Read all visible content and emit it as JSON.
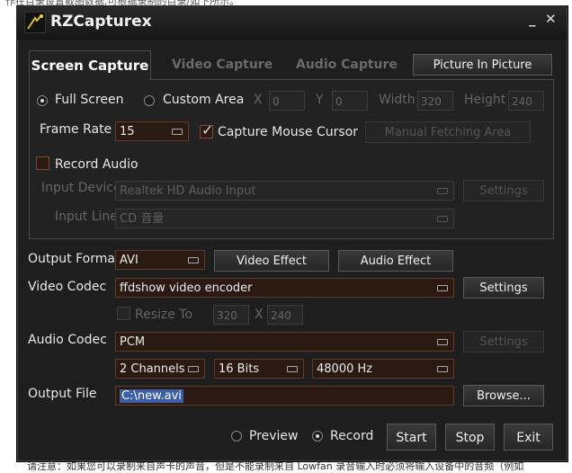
{
  "app": {
    "title": "RZCapturex",
    "minimize": "_",
    "close": "✕"
  },
  "tabs": [
    {
      "label": "Screen Capture",
      "active": true
    },
    {
      "label": "Video Capture"
    },
    {
      "label": "Audio Capture"
    }
  ],
  "pip_button": "Picture In Picture",
  "area": {
    "full_screen": "Full Screen",
    "custom_area": "Custom Area",
    "x_label": "X",
    "x_value": "0",
    "y_label": "Y",
    "y_value": "0",
    "width_label": "Width",
    "width_value": "320",
    "height_label": "Height",
    "height_value": "240"
  },
  "frame_rate": {
    "label": "Frame Rate",
    "value": "15"
  },
  "capture_mouse": "Capture Mouse Cursor",
  "manual_fetching": "Manual Fetching Area",
  "record_audio": "Record Audio",
  "input_device": {
    "label": "Input Device",
    "value": "Realtek HD Audio Input",
    "settings": "Settings"
  },
  "input_line": {
    "label": "Input Line",
    "value": "CD 音量"
  },
  "output_format": {
    "label": "Output Format",
    "value": "AVI",
    "video_effect": "Video Effect",
    "audio_effect": "Audio Effect"
  },
  "video_codec": {
    "label": "Video Codec",
    "value": "ffdshow video encoder",
    "settings": "Settings"
  },
  "resize": {
    "label": "Resize To",
    "w": "320",
    "x": "X",
    "h": "240"
  },
  "audio_codec": {
    "label": "Audio Codec",
    "value": "PCM",
    "settings": "Settings",
    "channels": "2 Channels",
    "bits": "16 Bits",
    "rate": "48000 Hz"
  },
  "output_file": {
    "label": "Output File",
    "value": "C:\\new.avi",
    "browse": "Browse..."
  },
  "mode": {
    "preview": "Preview",
    "record": "Record"
  },
  "actions": {
    "start": "Start",
    "stop": "Stop",
    "exit": "Exit"
  },
  "page_text": {
    "top": "作在目录设置截图数据,可根据录制的目录/如下所示。",
    "bottom": "请注意：如果您可以录制来自声卡的声音，但是不能录制来自 Lowfan 录音输入时必须将输入设备中的音频（例如"
  }
}
